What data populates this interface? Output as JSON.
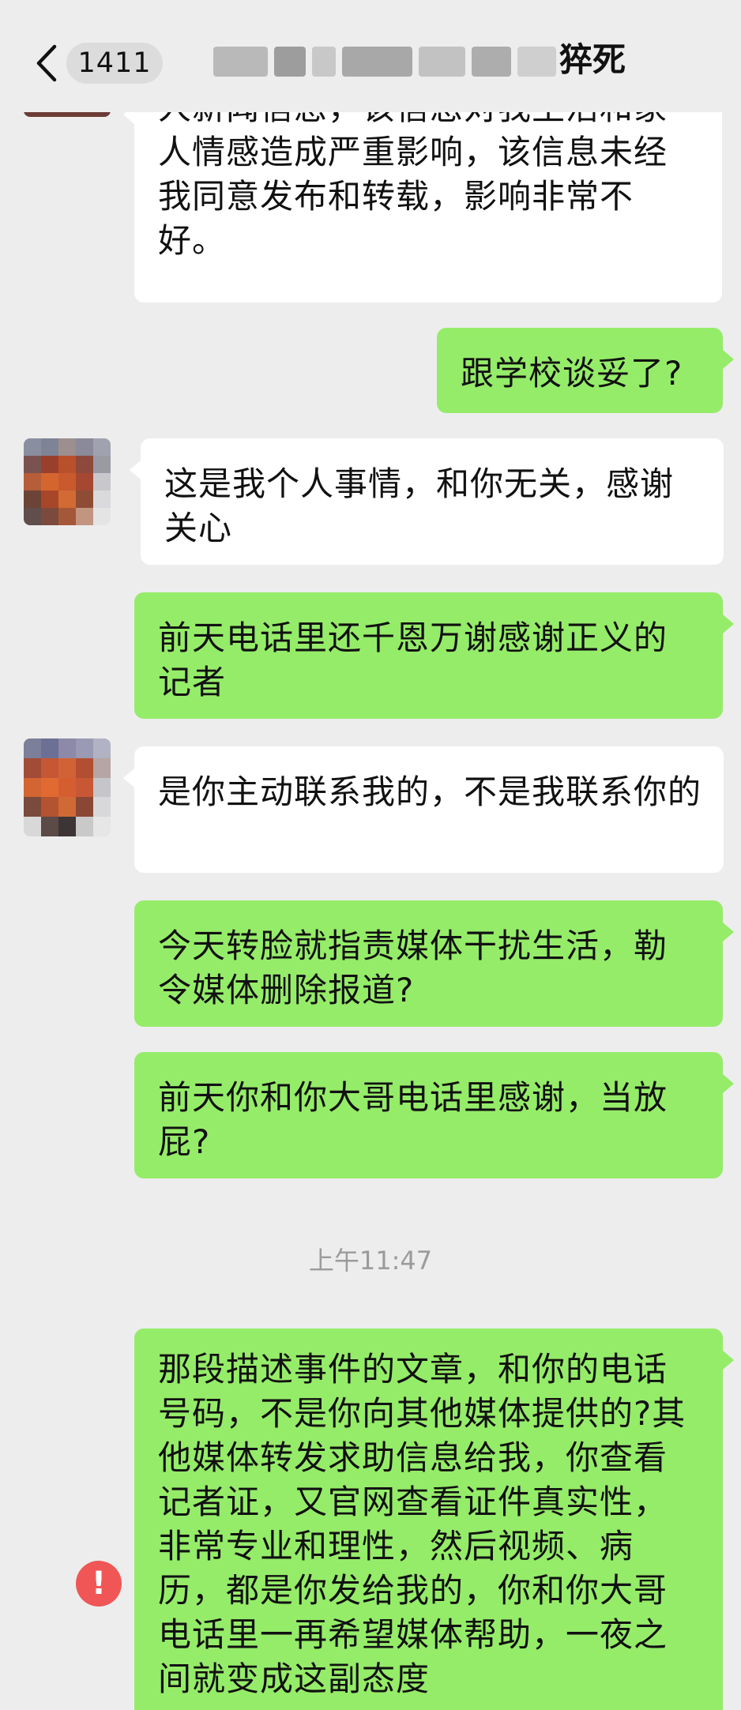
{
  "header": {
    "unread_count": "1411",
    "title_visible": "猝死",
    "back_icon": "chevron-left-icon"
  },
  "messages": [
    {
      "side": "in",
      "text": "人新闻信息，该信息对我生活和家人情感造成严重影响，该信息未经我同意发布和转载，影响非常不好。"
    },
    {
      "side": "out",
      "text": "跟学校谈妥了?"
    },
    {
      "side": "in",
      "text": "这是我个人事情，和你无关，感谢关心"
    },
    {
      "side": "out",
      "text": "前天电话里还千恩万谢感谢正义的记者"
    },
    {
      "side": "in",
      "text": "是你主动联系我的，不是我联系你的"
    },
    {
      "side": "out",
      "text": "今天转脸就指责媒体干扰生活，勒令媒体删除报道?"
    },
    {
      "side": "out",
      "text": "前天你和你大哥电话里感谢，当放屁?"
    },
    {
      "side": "out",
      "text": "那段描述事件的文章，和你的电话号码，不是你向其他媒体提供的?其他媒体转发求助信息给我，你查看记者证，又官网查看证件真实性，非常专业和理性，然后视频、病历，都是你发给我的，你和你大哥电话里一再希望媒体帮助，一夜之间就变成这副态度"
    }
  ],
  "timestamp": "上午11:47",
  "send_failed_icon": "!",
  "colors": {
    "background": "#ededed",
    "incoming_bubble": "#ffffff",
    "outgoing_bubble": "#95ec69",
    "error": "#f05656"
  }
}
